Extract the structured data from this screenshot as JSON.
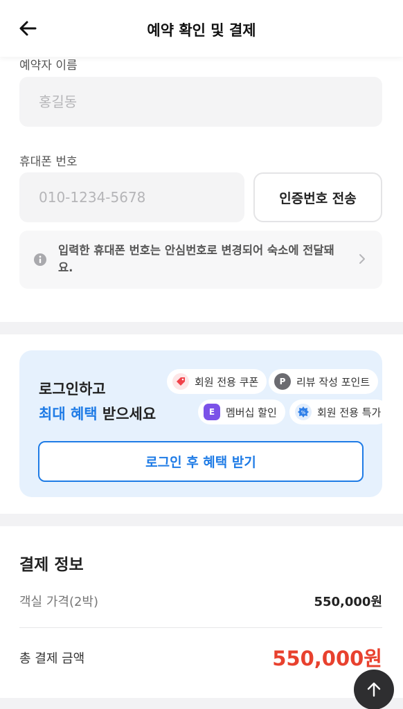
{
  "header": {
    "title": "예약 확인 및 결제"
  },
  "form": {
    "name_label": "예약자 이름",
    "name_placeholder": "홍길동",
    "phone_label": "휴대폰 번호",
    "phone_placeholder": "010-1234-5678",
    "verify_button": "인증번호 전송",
    "notice_text": "입력한 휴대폰 번호는 안심번호로 변경되어 숙소에 전달돼요."
  },
  "promo": {
    "line1": "로그인하고",
    "highlight": "최대 혜택",
    "line2_rest": " 받으세요",
    "chips": [
      {
        "label": "회원 전용 쿠폰",
        "icon": "coupon-tag-icon",
        "color": "#f0424a"
      },
      {
        "label": "리뷰 작성 포인트",
        "icon": "point-p-icon",
        "color": "#6b6b70"
      },
      {
        "label": "멤버십 할인",
        "icon": "membership-e-icon",
        "color": "#7b52e8"
      },
      {
        "label": "회원 전용 특가",
        "icon": "special-price-badge-icon",
        "color": "#2f7fe8"
      }
    ],
    "login_button": "로그인 후 혜택 받기"
  },
  "payment": {
    "title": "결제 정보",
    "room_price_label": "객실 가격(2박)",
    "room_price_value": "550,000원",
    "total_label": "총 결제 금액",
    "total_value": "550,000원"
  },
  "colors": {
    "accent": "#1e7be6",
    "price": "#e8412e"
  }
}
